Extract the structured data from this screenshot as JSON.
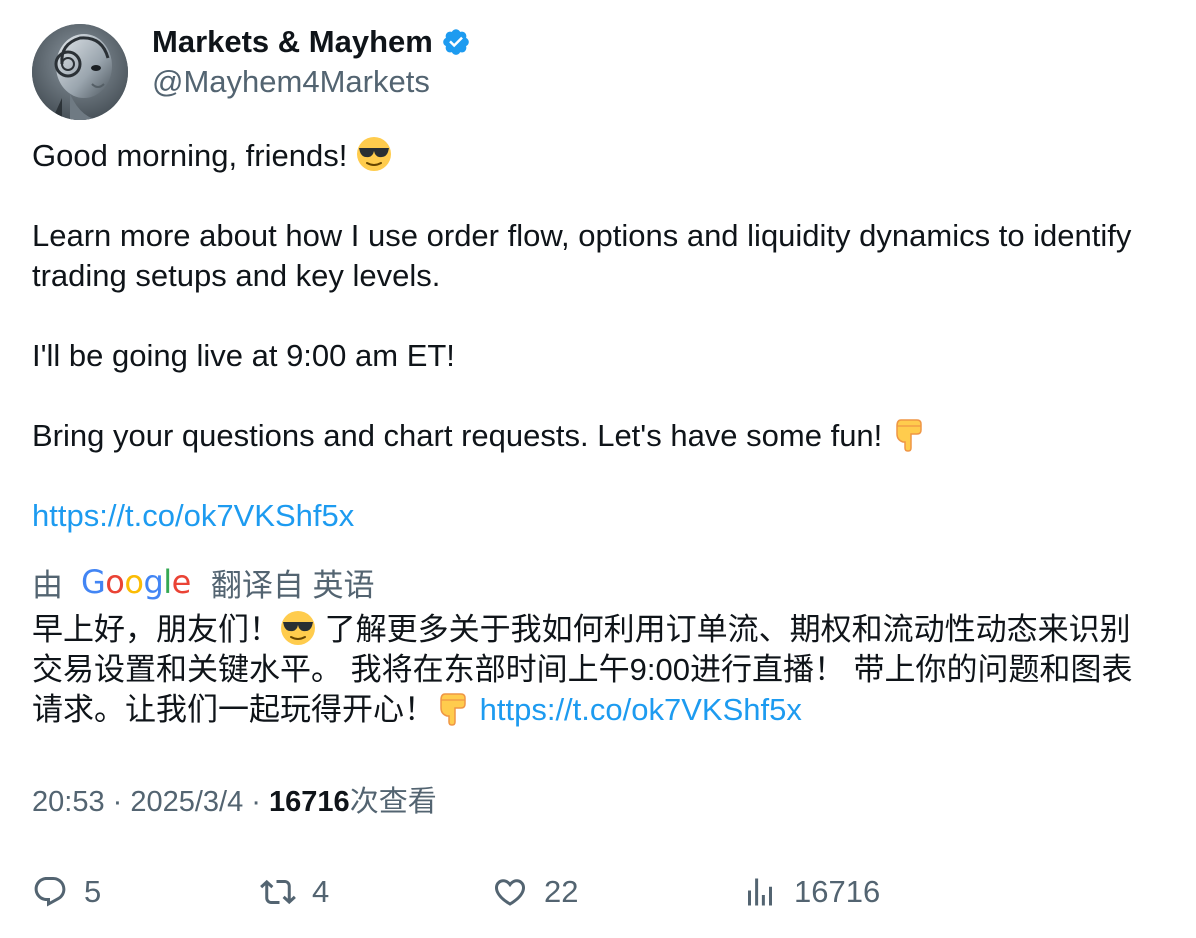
{
  "author": {
    "display_name": "Markets & Mayhem",
    "handle": "@Mayhem4Markets",
    "verified": true,
    "verified_icon": "verified-badge-icon",
    "avatar_icon": "robot-head-avatar"
  },
  "tweet": {
    "line1": "Good morning, friends!",
    "line2": "Learn more about how I use order flow, options and liquidity dynamics to identify trading setups and key levels.",
    "line3": "I'll be going live at 9:00 am ET!",
    "line4": "Bring your questions and chart requests. Let's have some fun!",
    "link": "https://t.co/ok7VKShf5x"
  },
  "translation": {
    "prefix": "由",
    "provider": "Google",
    "suffix": "翻译自 英语",
    "text_part1": "早上好，朋友们！",
    "text_part2": " 了解更多关于我如何利用订单流、期权和流动性动态来识别交易设置和关键水平。 我将在东部时间上午9:00进行直播！ 带上你的问题和图表请求。让我们一起玩得开心！",
    "link": "https://t.co/ok7VKShf5x"
  },
  "meta": {
    "time": "20:53",
    "separator": " · ",
    "date": "2025/3/4",
    "views_count": "16716",
    "views_label": "次查看"
  },
  "actions": {
    "replies": "5",
    "reposts": "4",
    "likes": "22",
    "views": "16716"
  },
  "colors": {
    "link": "#1d9bf0",
    "secondary_text": "#536471",
    "primary_text": "#0f1419",
    "verified": "#1d9bf0"
  }
}
